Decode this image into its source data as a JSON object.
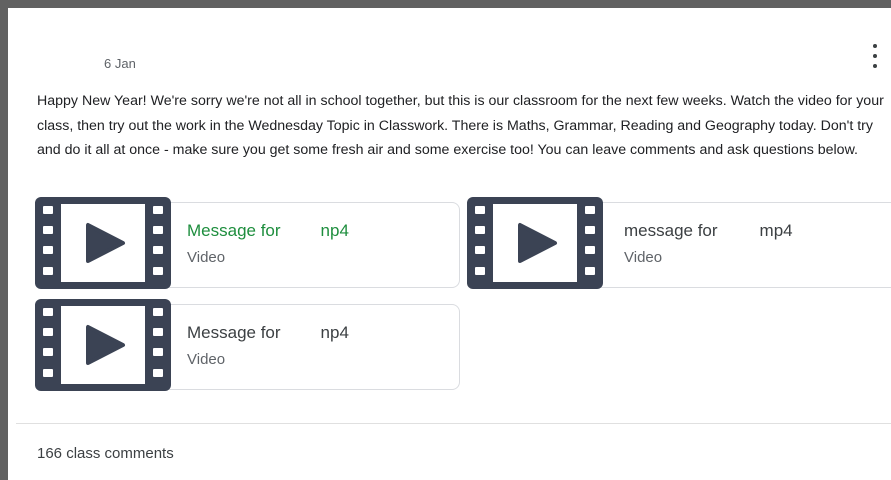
{
  "post": {
    "date": "6 Jan",
    "message": "Happy New Year!  We're sorry we're not all in school together, but this is our classroom for the next few weeks.  Watch the video for your class, then try out the work in the Wednesday Topic in Classwork.  There is Maths, Grammar, Reading and Geography today.  Don't try and do it all at once  - make sure you get some fresh air and some exercise too!  You can leave comments and ask questions below.",
    "menu_icon": "more-vert-icon"
  },
  "attachments": [
    {
      "title_start": "Message for",
      "title_end": "np4",
      "type": "Video",
      "icon": "video-film-icon",
      "title_color": "#1e8e3e"
    },
    {
      "title_start": "message for",
      "title_end": "mp4",
      "type": "Video",
      "icon": "video-film-icon"
    },
    {
      "title_start": "Message for",
      "title_end": "np4",
      "type": "Video",
      "icon": "video-film-icon"
    }
  ],
  "footer": {
    "comments": "166 class comments"
  },
  "colors": {
    "frame": "#616161",
    "film_icon": "#3b4354",
    "active_title": "#1e8e3e"
  }
}
